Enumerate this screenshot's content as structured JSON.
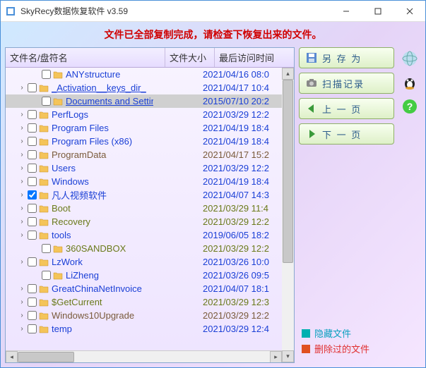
{
  "window": {
    "title": "SkyRecy数据恢复软件 v3.59"
  },
  "status": "文件已全部复制完成，请检查下恢复出来的文件。",
  "columns": {
    "name": "文件名/盘符名",
    "size": "文件大小",
    "time": "最后访问时间"
  },
  "buttons": {
    "save_as": "另 存 为",
    "scan_log": "扫描记录",
    "prev": "上 一 页",
    "next": "下 一 页"
  },
  "legend": {
    "hidden": "隐藏文件",
    "deleted": "删除过的文件"
  },
  "rows": [
    {
      "depth": 2,
      "expand": "",
      "name": "ANYstructure",
      "time": "2021/04/16 08:0",
      "style": "normal"
    },
    {
      "depth": 1,
      "expand": "›",
      "name": "_Activation__keys_dir_",
      "time": "2021/04/17 10:4",
      "style": "underline"
    },
    {
      "depth": 2,
      "expand": "",
      "name": "Documents and Settings",
      "time": "2015/07/10 20:2",
      "style": "underline",
      "selected": true
    },
    {
      "depth": 1,
      "expand": "›",
      "name": "PerfLogs",
      "time": "2021/03/29 12:2",
      "style": "normal"
    },
    {
      "depth": 1,
      "expand": "›",
      "name": "Program Files",
      "time": "2021/04/19 18:4",
      "style": "normal"
    },
    {
      "depth": 1,
      "expand": "›",
      "name": "Program Files (x86)",
      "time": "2021/04/19 18:4",
      "style": "normal"
    },
    {
      "depth": 1,
      "expand": "›",
      "name": "ProgramData",
      "time": "2021/04/17 15:2",
      "style": "dark"
    },
    {
      "depth": 1,
      "expand": "›",
      "name": "Users",
      "time": "2021/03/29 12:2",
      "style": "normal"
    },
    {
      "depth": 1,
      "expand": "›",
      "name": "Windows",
      "time": "2021/04/19 18:4",
      "style": "normal"
    },
    {
      "depth": 1,
      "expand": "›",
      "name": "凡人视频软件",
      "time": "2021/04/07 14:3",
      "style": "normal",
      "checked": true
    },
    {
      "depth": 1,
      "expand": "›",
      "name": "Boot",
      "time": "2021/03/29 11:4",
      "style": "olive"
    },
    {
      "depth": 1,
      "expand": "›",
      "name": "Recovery",
      "time": "2021/03/29 12:2",
      "style": "olive"
    },
    {
      "depth": 1,
      "expand": "›",
      "name": "tools",
      "time": "2019/06/05 18:2",
      "style": "normal"
    },
    {
      "depth": 2,
      "expand": "",
      "name": "360SANDBOX",
      "time": "2021/03/29 12:2",
      "style": "olive"
    },
    {
      "depth": 1,
      "expand": "›",
      "name": "LzWork",
      "time": "2021/03/26 10:0",
      "style": "normal"
    },
    {
      "depth": 2,
      "expand": "",
      "name": "LiZheng",
      "time": "2021/03/26 09:5",
      "style": "normal"
    },
    {
      "depth": 1,
      "expand": "›",
      "name": "GreatChinaNetInvoice",
      "time": "2021/04/07 18:1",
      "style": "normal"
    },
    {
      "depth": 1,
      "expand": "›",
      "name": "$GetCurrent",
      "time": "2021/03/29 12:3",
      "style": "olive"
    },
    {
      "depth": 1,
      "expand": "›",
      "name": "Windows10Upgrade",
      "time": "2021/03/29 12:2",
      "style": "dark"
    },
    {
      "depth": 1,
      "expand": "›",
      "name": "temp",
      "time": "2021/03/29 12:4",
      "style": "normal"
    }
  ]
}
